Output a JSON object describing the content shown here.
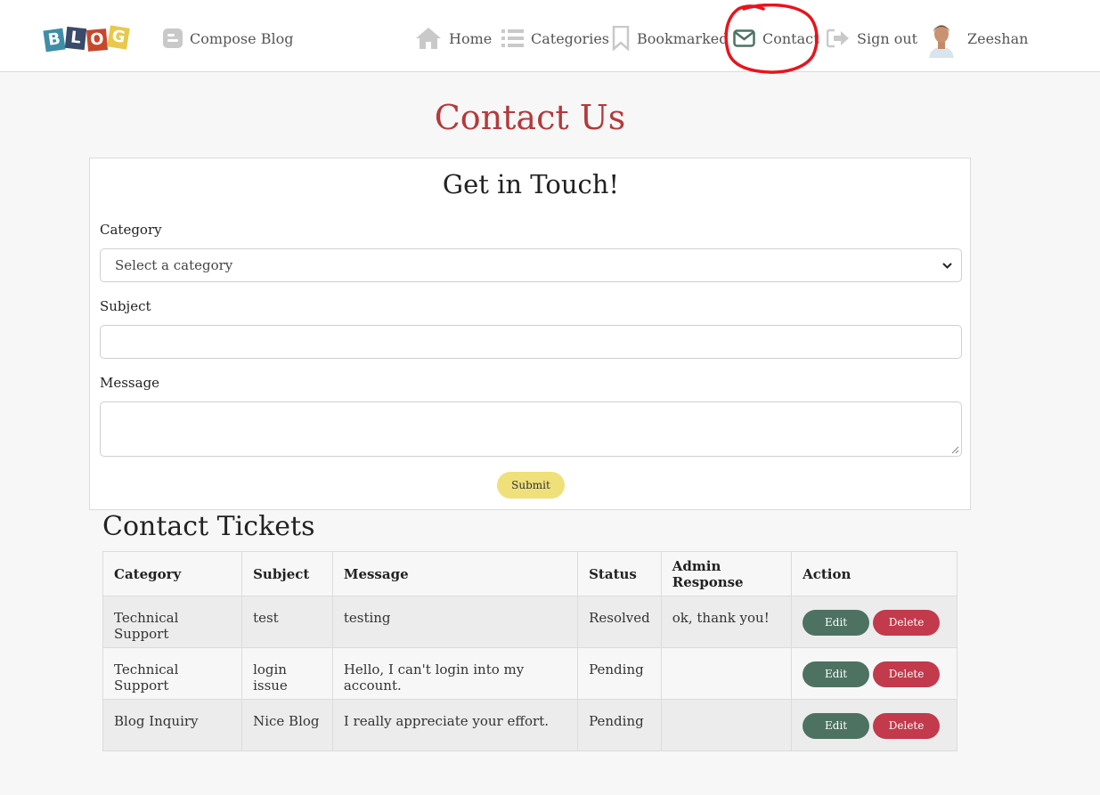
{
  "nav": {
    "logo_letters": [
      "B",
      "L",
      "O",
      "G"
    ],
    "logo_colors": [
      "#3e8ea8",
      "#3a4a6a",
      "#c8472c",
      "#e9c84a"
    ],
    "compose_label": "Compose Blog",
    "home_label": "Home",
    "categories_label": "Categories",
    "bookmarked_label": "Bookmarked",
    "contact_label": "Contact",
    "signout_label": "Sign out",
    "user_name": "Zeeshan"
  },
  "page": {
    "title": "Contact Us",
    "title_color": "#b5393c"
  },
  "form": {
    "heading": "Get in Touch!",
    "category_label": "Category",
    "category_placeholder": "Select a category",
    "subject_label": "Subject",
    "subject_value": "",
    "message_label": "Message",
    "message_value": "",
    "submit_label": "Submit"
  },
  "tickets": {
    "title": "Contact Tickets",
    "columns": [
      "Category",
      "Subject",
      "Message",
      "Status",
      "Admin Response",
      "Action"
    ],
    "rows": [
      {
        "category": "Technical Support",
        "subject": "test",
        "message": "testing",
        "status": "Resolved",
        "response": "ok, thank you!",
        "edit": "Edit",
        "delete": "Delete"
      },
      {
        "category": "Technical Support",
        "subject": "login issue",
        "message": "Hello, I can't login into my account.",
        "status": "Pending",
        "response": "",
        "edit": "Edit",
        "delete": "Delete"
      },
      {
        "category": "Blog Inquiry",
        "subject": "Nice Blog",
        "message": "I really appreciate your effort.",
        "status": "Pending",
        "response": "",
        "edit": "Edit",
        "delete": "Delete"
      }
    ]
  },
  "colors": {
    "accent_red": "#b5393c",
    "submit_yellow": "#efe07a",
    "edit_green": "#4d7262",
    "delete_red": "#c23a4b",
    "annotation_red": "#e8141c"
  }
}
